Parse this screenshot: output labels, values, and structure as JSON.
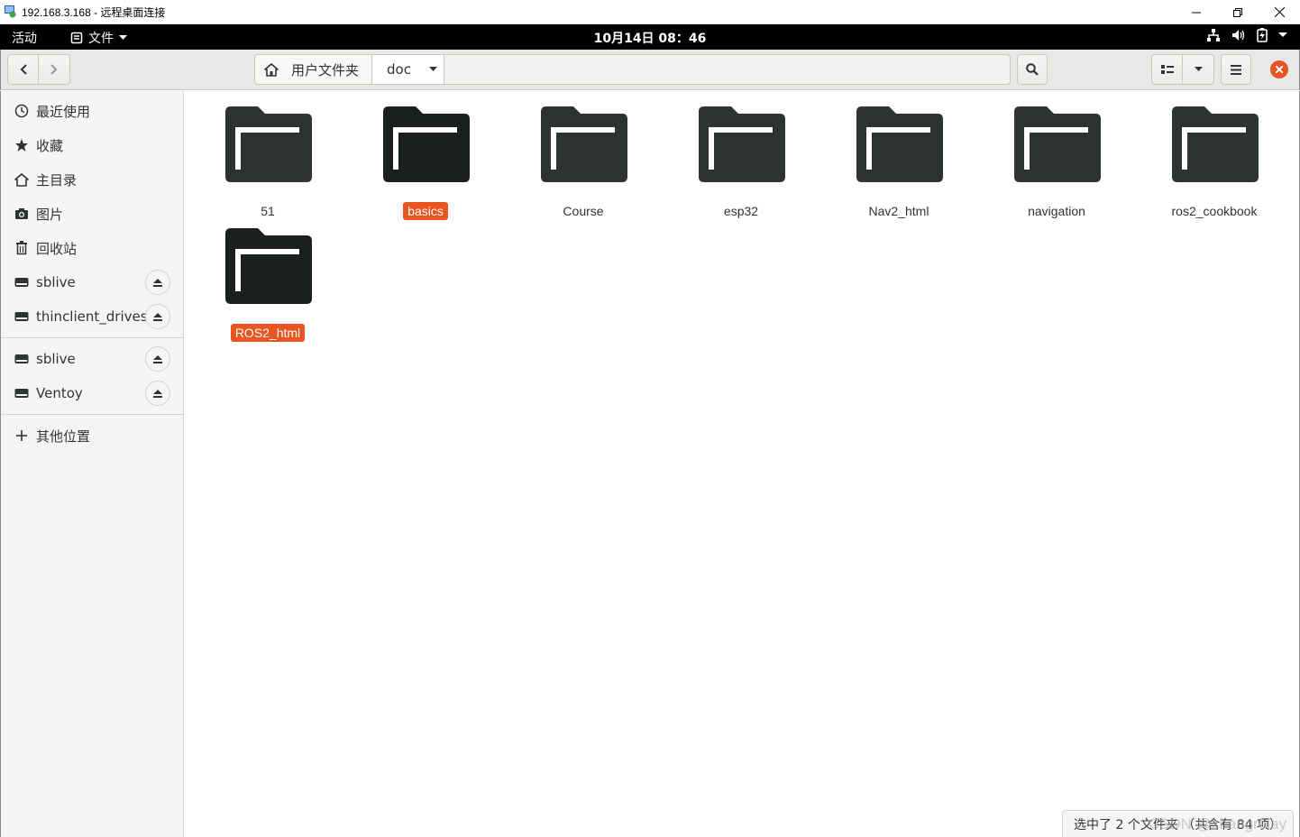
{
  "window": {
    "title": "192.168.3.168 - 远程桌面连接"
  },
  "topbar": {
    "activities": "活动",
    "app_menu": "文件",
    "clock": "10月14日  08：46"
  },
  "pathbar": {
    "home_label": "用户文件夹",
    "current": "doc"
  },
  "sidebar": {
    "items": [
      {
        "label": "最近使用",
        "icon": "clock-icon"
      },
      {
        "label": "收藏",
        "icon": "star-icon"
      },
      {
        "label": "主目录",
        "icon": "home-icon"
      },
      {
        "label": "图片",
        "icon": "camera-icon"
      },
      {
        "label": "回收站",
        "icon": "trash-icon"
      },
      {
        "label": "sblive",
        "icon": "drive-icon",
        "eject": true
      },
      {
        "label": "thinclient_drives",
        "icon": "drive-icon",
        "eject": true
      },
      {
        "label": "sblive",
        "icon": "drive-icon",
        "eject": true
      },
      {
        "label": "Ventoy",
        "icon": "drive-icon",
        "eject": true
      },
      {
        "label": "其他位置",
        "icon": "plus-icon"
      }
    ]
  },
  "folders": [
    {
      "name": "51",
      "selected": false
    },
    {
      "name": "basics",
      "selected": true
    },
    {
      "name": "Course",
      "selected": false
    },
    {
      "name": "esp32",
      "selected": false
    },
    {
      "name": "Nav2_html",
      "selected": false
    },
    {
      "name": "navigation",
      "selected": false
    },
    {
      "name": "ros2_cookbook",
      "selected": false
    },
    {
      "name": "ROS2_html",
      "selected": true
    }
  ],
  "status": {
    "text": "选中了 2 个文件夹 （共含有 84 项）"
  },
  "watermark": "CSDN @zhangrelay",
  "colors": {
    "selection": "#e95420",
    "folder": "#2d3331",
    "folder_selected": "#1b1f20",
    "close": "#e95420"
  }
}
